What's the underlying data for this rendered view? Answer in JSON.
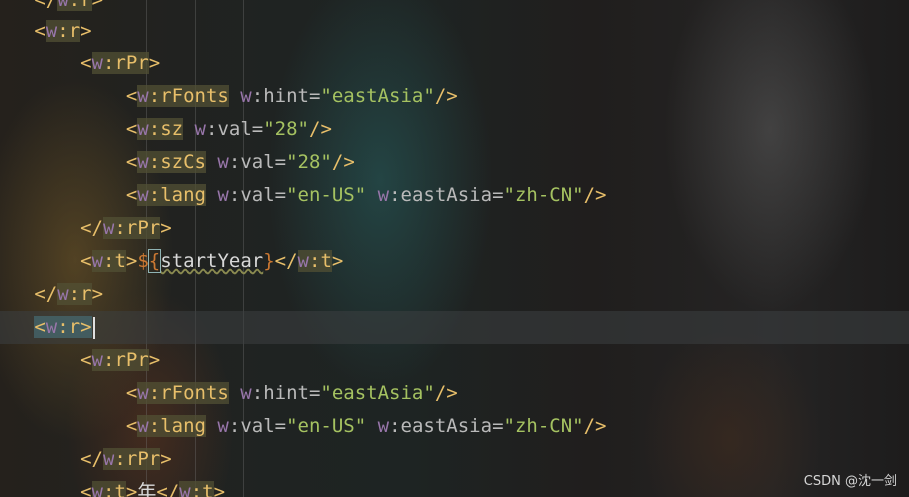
{
  "lines": [
    {
      "ind": "   ",
      "t1": "</",
      "ns": "w",
      "c": ":",
      "tag": "r",
      "t2": ">"
    },
    {
      "ind": "   ",
      "t1": "<",
      "ns": "w",
      "c": ":",
      "tag": "r",
      "t2": ">"
    },
    {
      "ind": "       ",
      "t1": "<",
      "ns": "w",
      "c": ":",
      "tag": "rPr",
      "t2": ">"
    },
    {
      "ind": "           ",
      "t1": "<",
      "ns": "w",
      "c": ":",
      "tag": "rFonts",
      "sp": " ",
      "ans": "w",
      "ac": ":",
      "attr": "hint",
      "eq": "=",
      "val": "\"eastAsia\"",
      "t2": "/>"
    },
    {
      "ind": "           ",
      "t1": "<",
      "ns": "w",
      "c": ":",
      "tag": "sz",
      "sp": " ",
      "ans": "w",
      "ac": ":",
      "attr": "val",
      "eq": "=",
      "val": "\"28\"",
      "t2": "/>"
    },
    {
      "ind": "           ",
      "t1": "<",
      "ns": "w",
      "c": ":",
      "tag": "szCs",
      "sp": " ",
      "ans": "w",
      "ac": ":",
      "attr": "val",
      "eq": "=",
      "val": "\"28\"",
      "t2": "/>"
    },
    {
      "ind": "           ",
      "t1": "<",
      "ns": "w",
      "c": ":",
      "tag": "lang",
      "sp": " ",
      "ans": "w",
      "ac": ":",
      "attr": "val",
      "eq": "=",
      "val": "\"en-US\"",
      "sp2": " ",
      "ans2": "w",
      "ac2": ":",
      "attr2": "eastAsia",
      "eq2": "=",
      "val2": "\"zh-CN\"",
      "t2": "/>"
    },
    {
      "ind": "       ",
      "t1": "</",
      "ns": "w",
      "c": ":",
      "tag": "rPr",
      "t2": ">"
    },
    {
      "ind": "       ",
      "t1": "<",
      "ns": "w",
      "c": ":",
      "tag": "t",
      "t2": ">",
      "dollar": "$",
      "lb": "{",
      "var": "startYear",
      "rb": "}",
      "t3": "</",
      "ns3": "w",
      "c3": ":",
      "tag3": "t",
      "t4": ">"
    },
    {
      "ind": "   ",
      "t1": "</",
      "ns": "w",
      "c": ":",
      "tag": "r",
      "t2": ">"
    },
    {
      "ind": "   ",
      "t1": "<",
      "ns": "w",
      "c": ":",
      "tag": "r",
      "t2": ">"
    },
    {
      "ind": "       ",
      "t1": "<",
      "ns": "w",
      "c": ":",
      "tag": "rPr",
      "t2": ">"
    },
    {
      "ind": "           ",
      "t1": "<",
      "ns": "w",
      "c": ":",
      "tag": "rFonts",
      "sp": " ",
      "ans": "w",
      "ac": ":",
      "attr": "hint",
      "eq": "=",
      "val": "\"eastAsia\"",
      "t2": "/>"
    },
    {
      "ind": "           ",
      "t1": "<",
      "ns": "w",
      "c": ":",
      "tag": "lang",
      "sp": " ",
      "ans": "w",
      "ac": ":",
      "attr": "val",
      "eq": "=",
      "val": "\"en-US\"",
      "sp2": " ",
      "ans2": "w",
      "ac2": ":",
      "attr2": "eastAsia",
      "eq2": "=",
      "val2": "\"zh-CN\"",
      "t2": "/>"
    },
    {
      "ind": "       ",
      "t1": "</",
      "ns": "w",
      "c": ":",
      "tag": "rPr",
      "t2": ">"
    },
    {
      "ind": "       ",
      "t1": "<",
      "ns": "w",
      "c": ":",
      "tag": "t",
      "t2": ">",
      "txt": "年",
      "t3": "</",
      "ns3": "w",
      "c3": ":",
      "tag3": "t",
      "t4": ">"
    }
  ],
  "watermark": "CSDN @沈一剑"
}
